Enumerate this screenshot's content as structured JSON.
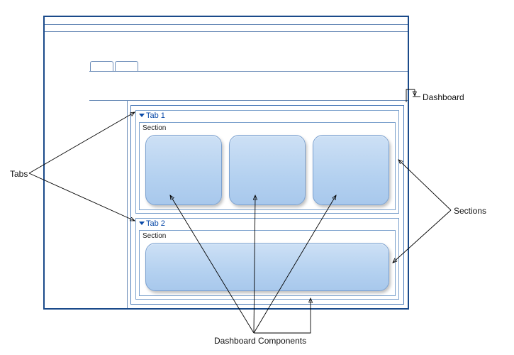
{
  "callouts": {
    "dashboard": "Dashboard",
    "tabs": "Tabs",
    "sections": "Sections",
    "components": "Dashboard Components"
  },
  "tabs": [
    {
      "label": "Tab 1",
      "section_label": "Section",
      "components": 3
    },
    {
      "label": "Tab 2",
      "section_label": "Section",
      "components": 1
    }
  ]
}
